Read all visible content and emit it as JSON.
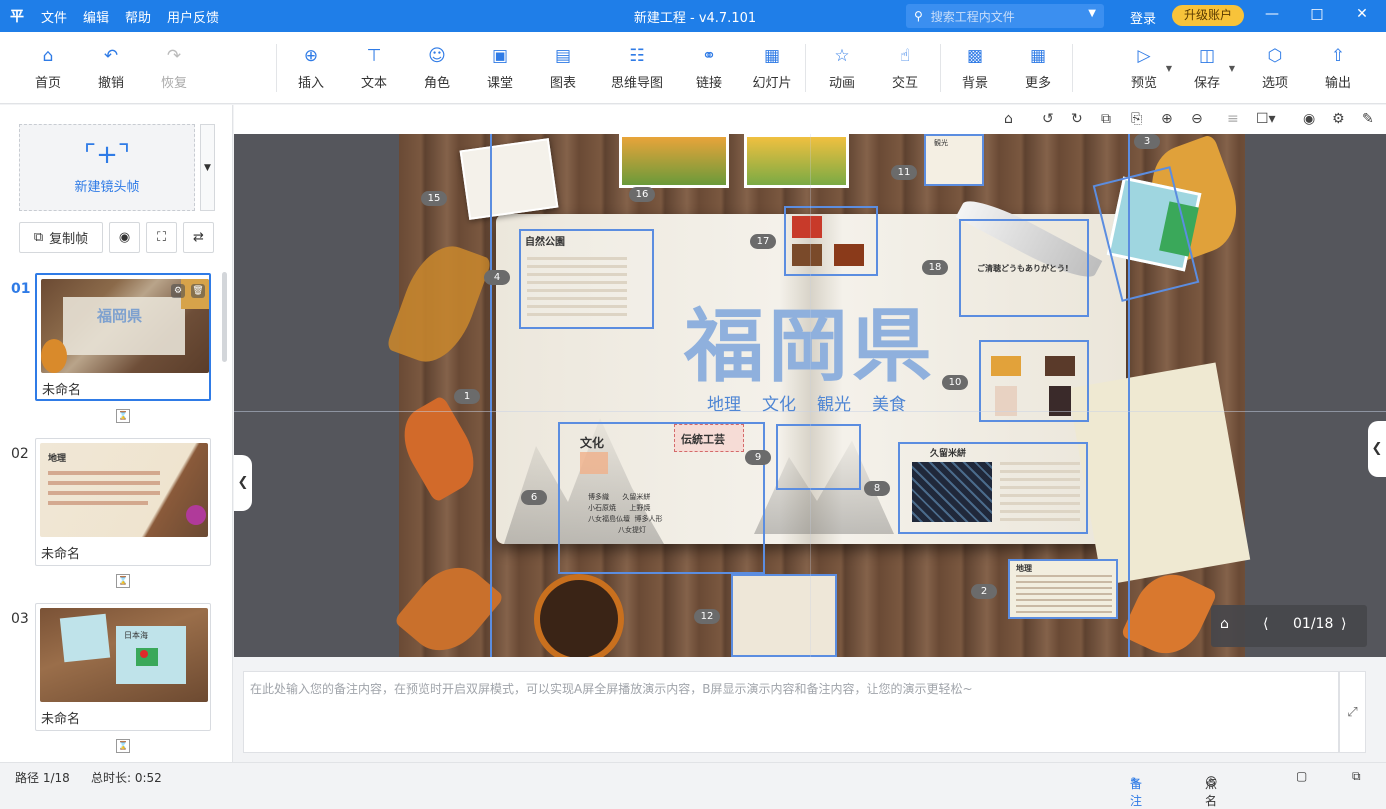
{
  "titlebar": {
    "logo": "平",
    "menu": [
      "文件",
      "编辑",
      "帮助",
      "用户反馈"
    ],
    "title": "新建工程 - v4.7.101",
    "search_placeholder": "搜索工程内文件",
    "login": "登录",
    "upgrade": "升级账户"
  },
  "toolbar": {
    "home": "首页",
    "undo": "撤销",
    "redo": "恢复",
    "insert": "插入",
    "text": "文本",
    "role": "角色",
    "class": "课堂",
    "chart": "图表",
    "mindmap": "思维导图",
    "link": "链接",
    "slide": "幻灯片",
    "animation": "动画",
    "interact": "交互",
    "background": "背景",
    "more": "更多",
    "preview": "预览",
    "save": "保存",
    "options": "选项",
    "export": "输出"
  },
  "left": {
    "new_frame": "新建镜头帧",
    "copy_frame": "复制帧",
    "frames": [
      {
        "num": "01",
        "caption": "未命名",
        "thumb_title": "福岡県"
      },
      {
        "num": "02",
        "caption": "未命名",
        "thumb_title": "地理"
      },
      {
        "num": "03",
        "caption": "未命名",
        "thumb_title": "日本海"
      }
    ]
  },
  "canvas": {
    "main_title": "福岡県",
    "subtitle": [
      "地理",
      "文化",
      "観光",
      "美食"
    ],
    "labels": {
      "nature_park": "自然公園",
      "culture": "文化",
      "crafts": "伝統工芸",
      "kurume": "久留米絣",
      "geography": "地理",
      "thanks": "ご清聴どうもありがとう!",
      "sightseeing": "観光",
      "culture_list": [
        "博多織",
        "久留米絣",
        "小石原焼",
        "上野焼",
        "八女福島仏壇",
        "博多人形",
        "八女提灯"
      ]
    },
    "markers": [
      "1",
      "2",
      "3",
      "4",
      "6",
      "8",
      "9",
      "10",
      "11",
      "12",
      "15",
      "16",
      "17",
      "18"
    ],
    "pager": "01/18"
  },
  "notes": {
    "placeholder": "在此处输入您的备注内容，在预览时开启双屏模式，可以实现A屏全屏播放演示内容，B屏显示演示内容和备注内容，让您的演示更轻松~"
  },
  "status": {
    "path": "路径 1/18",
    "duration": "总时长: 0:52",
    "notes_btn": "备注",
    "rollcall_btn": "点名"
  },
  "colors": {
    "accent": "#1f7ee8",
    "upgrade": "#f8c33a"
  }
}
